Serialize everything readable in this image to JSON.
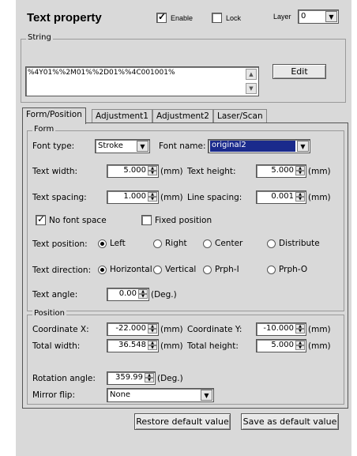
{
  "header": {
    "title": "Text property",
    "enable_label": "Enable",
    "lock_label": "Lock",
    "layer_label": "Layer",
    "layer_value": "0"
  },
  "string": {
    "group_label": "String",
    "value": "%4Y01%%2M01%%2D01%%4C001001%",
    "edit_label": "Edit"
  },
  "tabs": [
    "Form/Position",
    "Adjustment1",
    "Adjustment2",
    "Laser/Scan"
  ],
  "form": {
    "group_label": "Form",
    "font_type_label": "Font type:",
    "font_type_value": "Stroke",
    "font_name_label": "Font name:",
    "font_name_value": "original2",
    "text_width_label": "Text width:",
    "text_width_value": "5.000",
    "text_height_label": "Text height:",
    "text_height_value": "5.000",
    "text_spacing_label": "Text spacing:",
    "text_spacing_value": "1.000",
    "line_spacing_label": "Line spacing:",
    "line_spacing_value": "0.001",
    "mm": "(mm)",
    "deg": "(Deg.)",
    "no_font_space_label": "No font space",
    "fixed_position_label": "Fixed position",
    "text_position_label": "Text position:",
    "pos_left": "Left",
    "pos_right": "Right",
    "pos_center": "Center",
    "pos_distribute": "Distribute",
    "text_direction_label": "Text direction:",
    "dir_horizontal": "Horizontal",
    "dir_vertical": "Vertical",
    "dir_prph_i": "Prph-I",
    "dir_prph_o": "Prph-O",
    "text_angle_label": "Text angle:",
    "text_angle_value": "0.00"
  },
  "position": {
    "group_label": "Position",
    "coord_x_label": "Coordinate X:",
    "coord_x_value": "-22.000",
    "coord_y_label": "Coordinate Y:",
    "coord_y_value": "-10.000",
    "total_width_label": "Total width:",
    "total_width_value": "36.548",
    "total_height_label": "Total height:",
    "total_height_value": "5.000",
    "rotation_label": "Rotation angle:",
    "rotation_value": "359.99",
    "mirror_label": "Mirror flip:",
    "mirror_value": "None"
  },
  "footer": {
    "restore_label": "Restore default value",
    "save_label": "Save as default value"
  },
  "colors": {
    "panel": "#d9d9d9",
    "selection": "#1a2a8c"
  }
}
